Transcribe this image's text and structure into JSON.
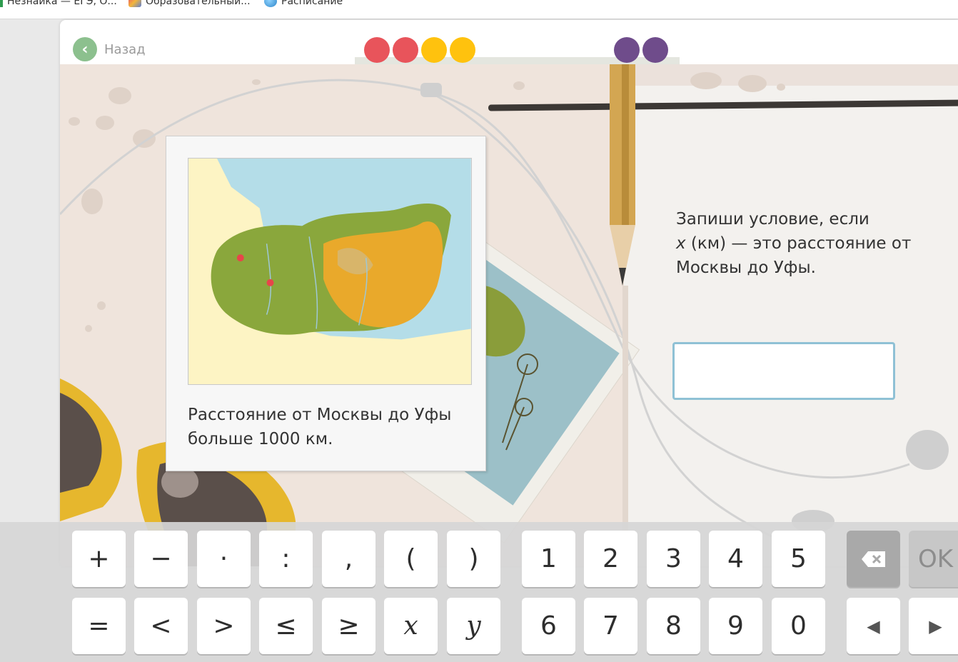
{
  "bookmarks": [
    {
      "label": "Незнайка — ЕГЭ, О...",
      "icon": "green-bookmark-icon"
    },
    {
      "label": "Образовательный...",
      "icon": "colorful-site-icon"
    },
    {
      "label": "Расписание",
      "icon": "globe-icon"
    }
  ],
  "nav": {
    "back_label": "Назад"
  },
  "progress": {
    "dots": [
      "#e8545b",
      "#e8545b",
      "#ffc20e",
      "#ffc20e",
      "#6f4c8b",
      "#6f4c8b"
    ]
  },
  "card": {
    "text": "Расстояние от Москвы до Уфы больше 1000 км."
  },
  "question": {
    "line1": "Запиши условие, если",
    "var": "x",
    "line2": " (км) — это расстояние от",
    "line3": "Москвы до Уфы."
  },
  "answer": {
    "value": ""
  },
  "keyboard": {
    "row1": [
      "+",
      "−",
      "·",
      ":",
      ",",
      "(",
      ")"
    ],
    "row2": [
      "=",
      "<",
      ">",
      "≤",
      "≥",
      "x",
      "y"
    ],
    "digits1": [
      "1",
      "2",
      "3",
      "4",
      "5"
    ],
    "digits2": [
      "6",
      "7",
      "8",
      "9",
      "0"
    ],
    "ok": "OK",
    "backspace_icon": "backspace-icon",
    "left_icon": "arrow-left-icon",
    "right_icon": "arrow-right-icon"
  },
  "colors": {
    "accent": "#8cc08e",
    "input_border": "#8fc1d5"
  }
}
